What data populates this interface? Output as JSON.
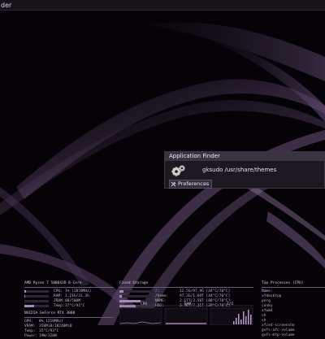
{
  "top_panel": {
    "title": "der"
  },
  "app_finder": {
    "title": "Application Finder",
    "command": "gksudo /usr/share/themes",
    "preferences_label": "Preferences"
  },
  "conky": {
    "cpu": {
      "header": "AMD Ryzen 7 5800X3D 8-Core",
      "rows": [
        {
          "label": "CPU:",
          "value": "1% (2870MHz)",
          "bar": 0.05
        },
        {
          "label": "RAM:",
          "value": "1.21G/31.3G",
          "bar": 0.04
        },
        {
          "label": "ZRAM:",
          "value": "0B/500M",
          "bar": 0.0
        },
        {
          "label": "Temp:",
          "value": "37°C/91°C",
          "bar": 0.4
        }
      ]
    },
    "gpu": {
      "header": "NVIDIA GeForce RTX 3080",
      "rows": [
        {
          "label": "GPU:",
          "value": "0% (210MHz)"
        },
        {
          "label": "VRAM:",
          "value": "358MiB/10240MiB"
        },
        {
          "label": "Temp:",
          "value": "35°C/93°C"
        },
        {
          "label": "Power:",
          "value": "19W/320W"
        }
      ]
    },
    "storage": {
      "header": "Fixed Storage",
      "rows": [
        {
          "label": "/:",
          "value": "12.5G/97.9G [44°C/70°C]",
          "bar": 0.13
        },
        {
          "label": "/home:",
          "value": "97.3G/1.69T [44°C/70°C]",
          "bar": 0.06
        },
        {
          "label": "NVME:",
          "value": "2.17T/3.58T [80°C/70°C]",
          "bar": 0.61
        },
        {
          "label": "HDD:",
          "value": "3.46T/7.21T [39°C/70°C]",
          "bar": 0.48
        }
      ],
      "graph_labels": [
        "CPU",
        "RAM",
        "I/O"
      ]
    },
    "procs": {
      "header": "Top Processes (CPU)",
      "col": "Name:",
      "items": [
        "xfdesktop",
        "perg",
        "conky",
        "xfwm4",
        "sh",
        "sh",
        "xfce4-screensho",
        "gvfs-afc-volume",
        "gvfs-mtp-volume"
      ]
    }
  }
}
